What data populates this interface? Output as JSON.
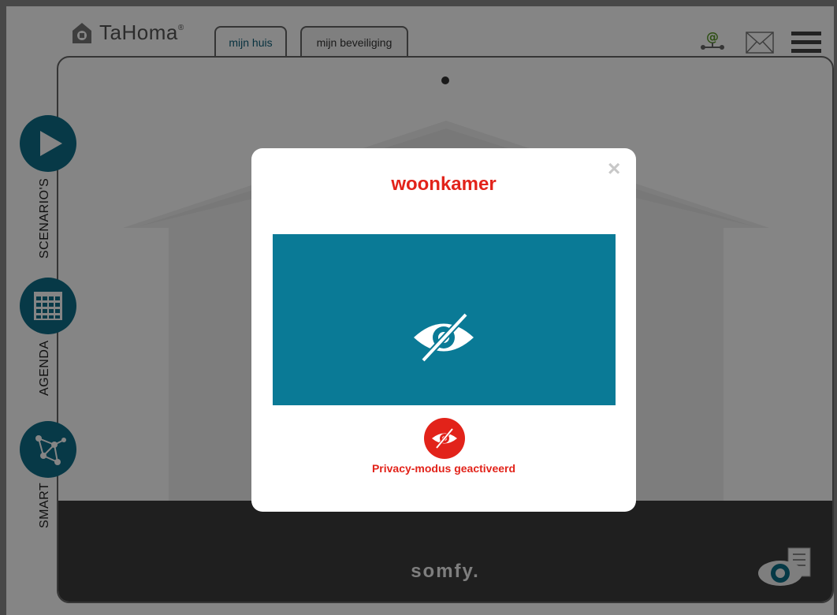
{
  "app": {
    "logo_text": "TaHoma",
    "logo_reg": "®"
  },
  "tabs": [
    {
      "label": "mijn huis",
      "active": true
    },
    {
      "label": "mijn beveiliging",
      "active": false
    }
  ],
  "header_icons": [
    "at-sign-network-icon",
    "mail-icon",
    "hamburger-menu-icon"
  ],
  "side_nav": [
    {
      "label": "SCENARIO'S",
      "icon": "play-icon"
    },
    {
      "label": "AGENDA",
      "icon": "calendar-grid-icon"
    },
    {
      "label": "SMART",
      "icon": "network-nodes-icon"
    }
  ],
  "footer": {
    "brand": "somfy."
  },
  "modal": {
    "title": "woonkamer",
    "close_label": "×",
    "status_text": "Privacy-modus geactiveerd",
    "camera_icon": "eye-slash-icon"
  },
  "colors": {
    "accent": "#0f6e88",
    "camera_bg": "#0a7a96",
    "alert": "#e2231a",
    "footer": "#3c3c3c"
  }
}
